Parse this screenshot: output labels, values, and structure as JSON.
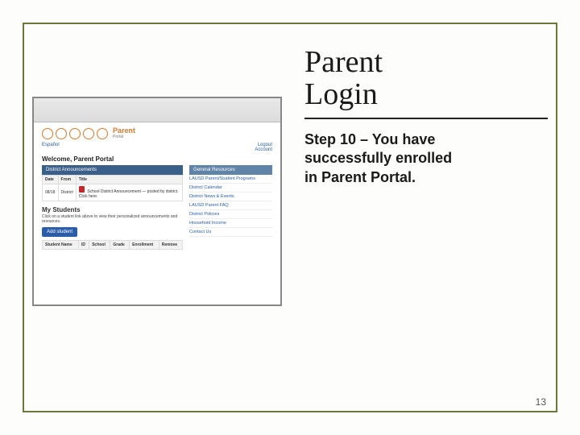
{
  "slide": {
    "title_line1": "Parent",
    "title_line2": "Login",
    "step_text": "Step 10 – You have successfully enrolled in Parent Portal.",
    "page_number": "13"
  },
  "portal": {
    "logo_text": "Parent",
    "logo_sub": "Portal",
    "lang_left": "Español",
    "lang_right_1": "Logout",
    "lang_right_2": "Account",
    "welcome": "Welcome, Parent Portal",
    "announcements_header_left": "District Announcements",
    "announcements_header_right": "General Resources",
    "ann_cols": {
      "date": "Date",
      "from": "From",
      "title": "Title"
    },
    "ann_row": {
      "date": "08/18",
      "from": "District",
      "title_text": "School District Announcement — posted by district. Click here."
    },
    "my_students_header": "My Students",
    "my_students_sub": "Click on a student link above to view their personalized announcements and resources.",
    "add_button": "Add student",
    "student_cols": {
      "name": "Student Name",
      "id": "ID",
      "school": "School",
      "grade": "Grade",
      "enroll": "Enrollment",
      "remove": "Remove"
    },
    "resources": [
      "LAUSD Parent/Student Programs",
      "District Calendar",
      "District News & Events",
      "LAUSD Parent FAQ",
      "District Policies",
      "Household Income",
      "Contact Us"
    ]
  }
}
